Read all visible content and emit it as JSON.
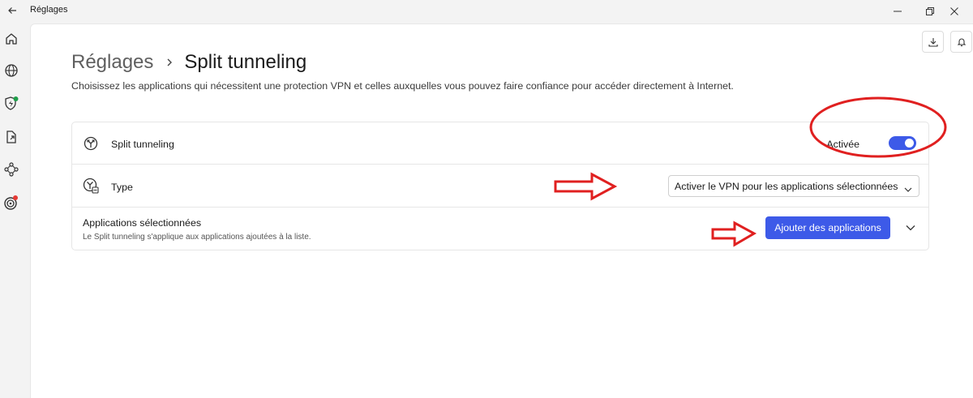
{
  "window": {
    "title": "Réglages",
    "controls": [
      "minimize-icon",
      "restore-icon",
      "close-icon"
    ]
  },
  "sidebar": {
    "items": [
      {
        "name": "home",
        "icon": "home-icon"
      },
      {
        "name": "globe",
        "icon": "globe-icon"
      },
      {
        "name": "shield",
        "icon": "shield-bolt-icon",
        "badge_color": "#1e9e4a"
      },
      {
        "name": "file-share",
        "icon": "file-share-icon"
      },
      {
        "name": "network",
        "icon": "network-icon"
      },
      {
        "name": "target",
        "icon": "target-icon",
        "badge_color": "#e53935"
      }
    ]
  },
  "toolbar": {
    "icons": [
      "download-icon",
      "bell-icon"
    ]
  },
  "breadcrumb": {
    "parent": "Réglages",
    "current": "Split tunneling"
  },
  "description": "Choisissez les applications qui nécessitent une protection VPN et celles auxquelles vous pouvez faire confiance pour accéder directement à Internet.",
  "settings": {
    "split_tunneling": {
      "label": "Split tunneling",
      "state_label": "Activée",
      "enabled": true
    },
    "type": {
      "label": "Type",
      "selected": "Activer le VPN pour les applications sélectionnées"
    },
    "apps": {
      "title": "Applications sélectionnées",
      "subtitle": "Le Split tunneling s'applique aux applications ajoutées à la liste.",
      "add_button": "Ajouter des applications"
    }
  },
  "colors": {
    "accent": "#3d5ae8",
    "annotation": "#e02020"
  }
}
